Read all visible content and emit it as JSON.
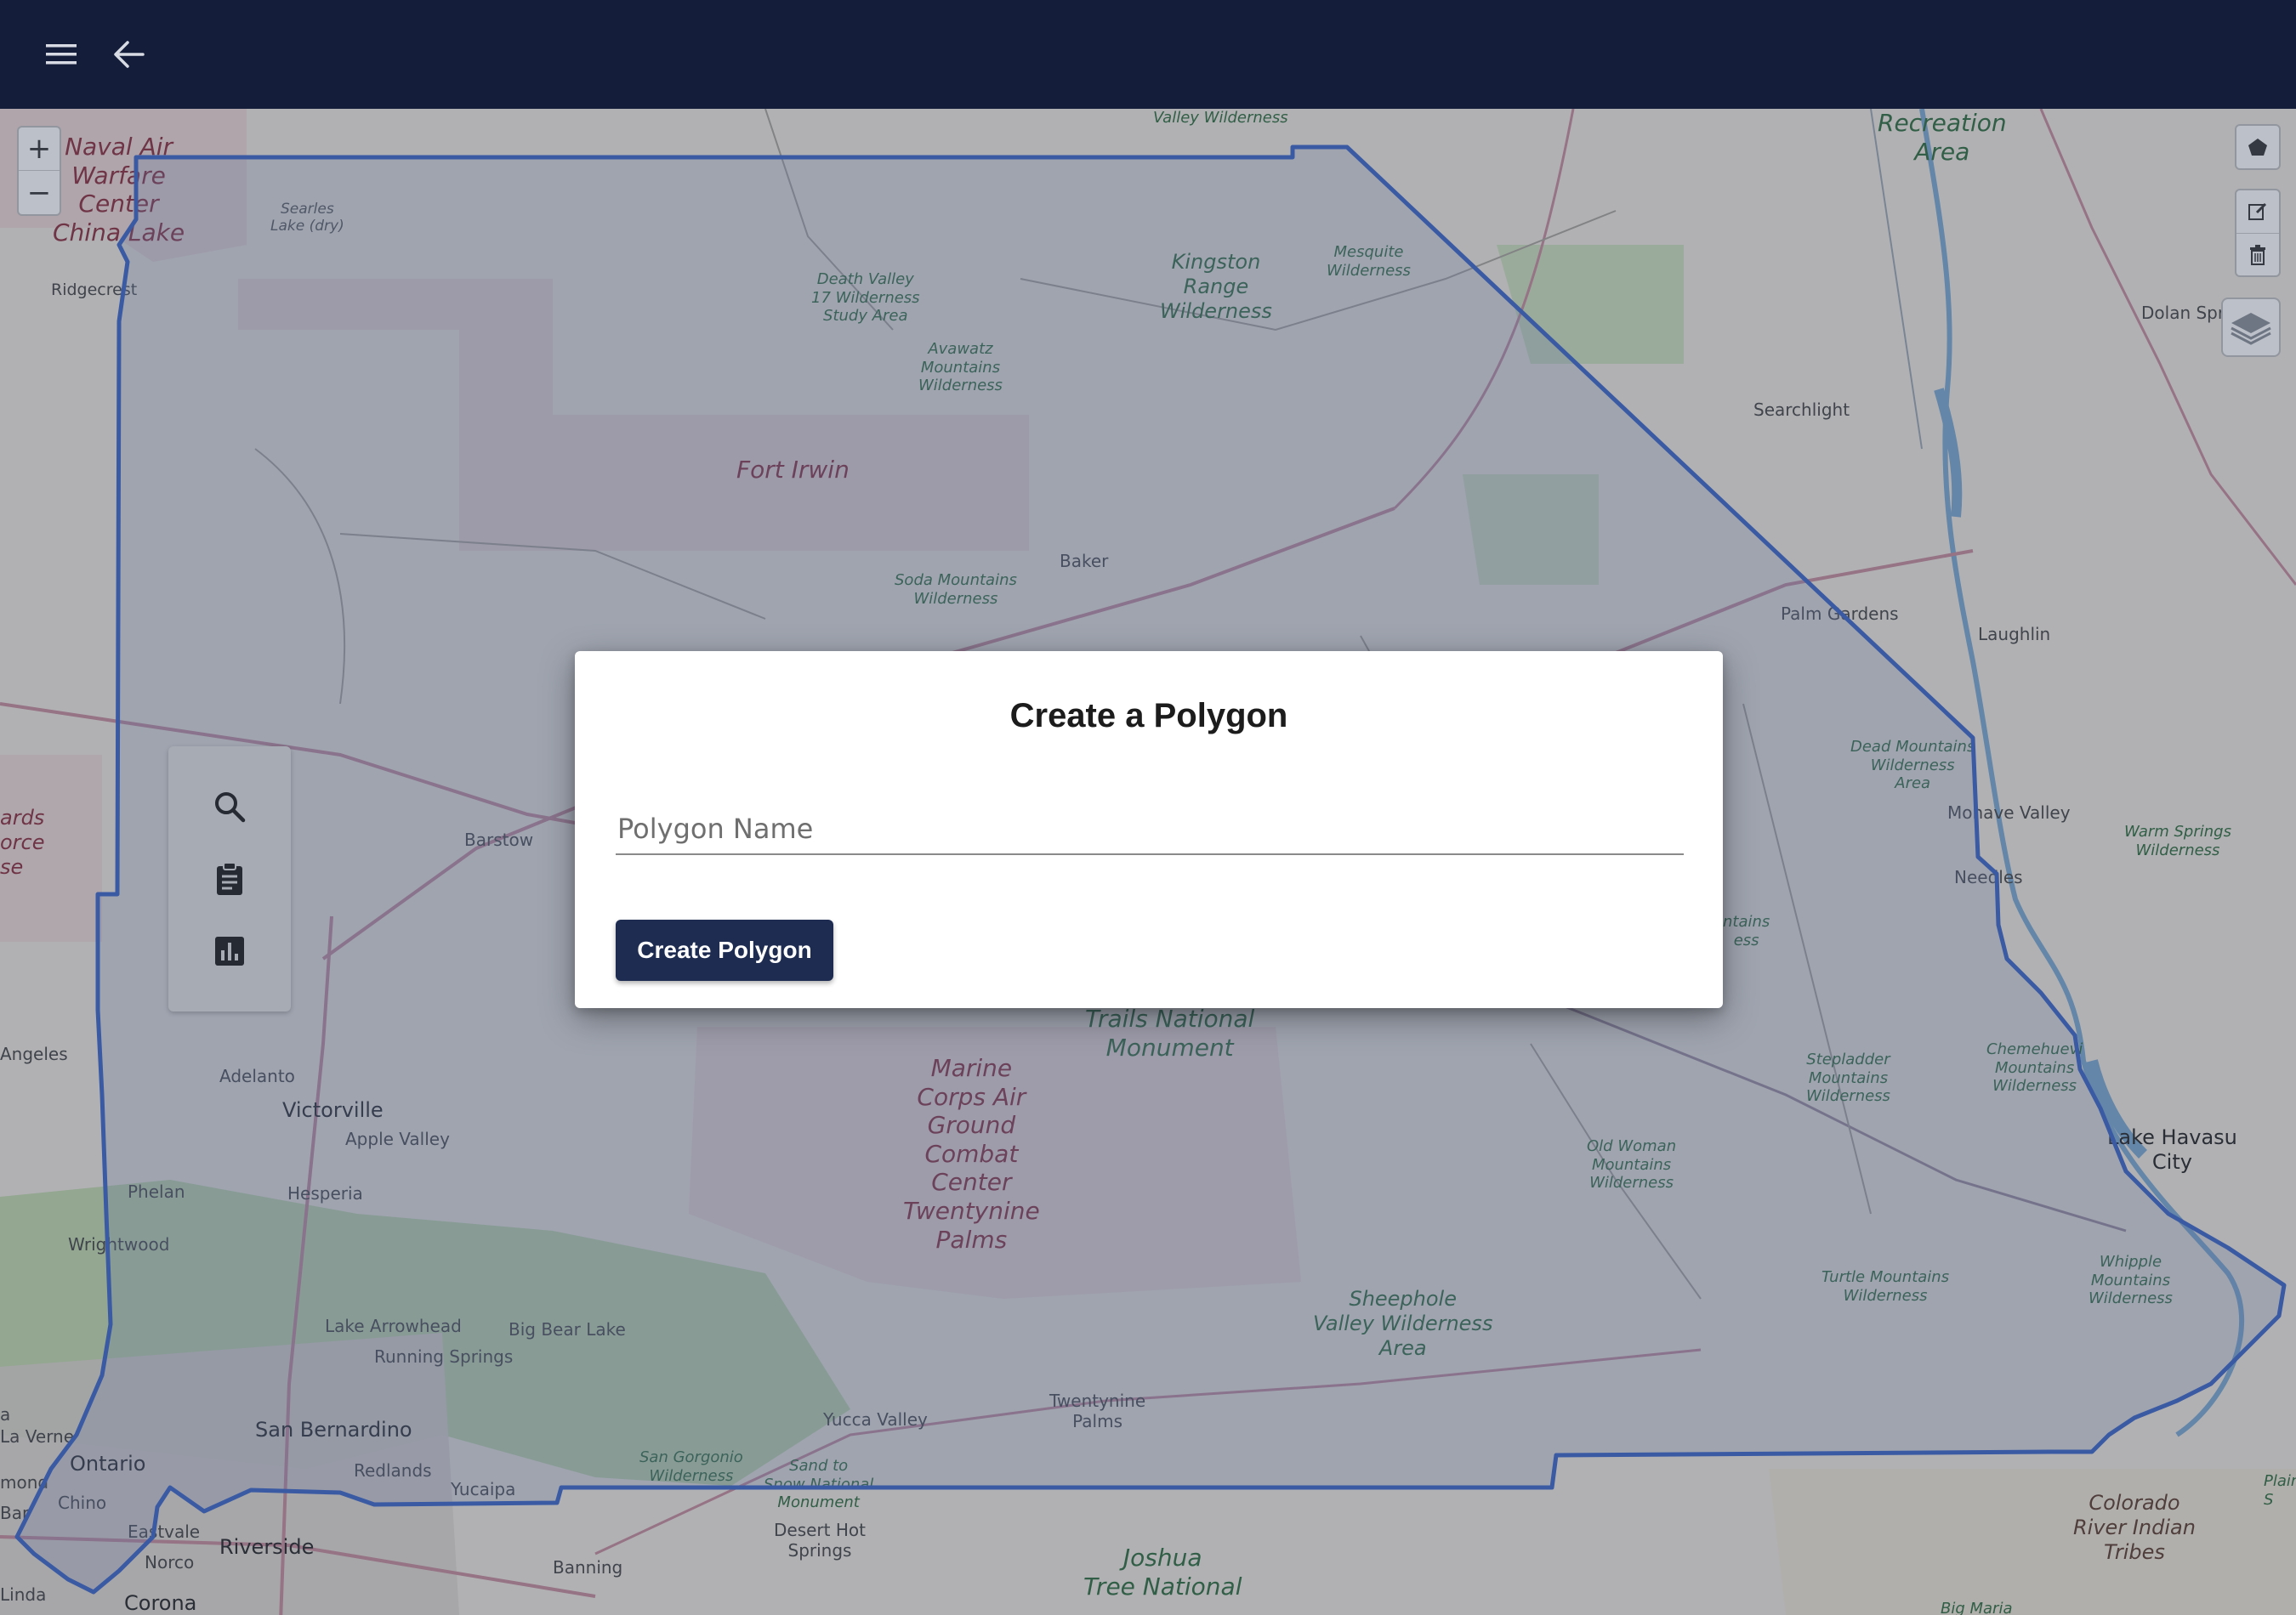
{
  "topbar": {
    "menu_icon": "menu-icon",
    "back_icon": "arrow-left-icon",
    "background": "#141e3a"
  },
  "map": {
    "zoom_in_label": "+",
    "zoom_out_label": "−",
    "tools": {
      "draw_polygon": "polygon-icon",
      "edit_layers": "edit-icon",
      "delete_layers": "trash-icon",
      "layer_switcher": "layers-icon"
    },
    "polygon_color": "#3a64c8",
    "labels": {
      "naval": "Naval Air\nWarfare\nCenter\nChina Lake",
      "searles": "Searles\nLake (dry)",
      "ridgecrest": "Ridgecrest",
      "valley_wild": "Valley Wilderness",
      "recreation": "Recreation\nArea",
      "death_valley": "Death Valley\n17 Wilderness\nStudy Area",
      "kingston": "Kingston\nRange\nWilderness",
      "mesquite": "Mesquite\nWilderness",
      "avawatz": "Avawatz\nMountains\nWilderness",
      "dolan": "Dolan Spr",
      "fort_irwin": "Fort Irwin",
      "searchlight": "Searchlight",
      "baker": "Baker",
      "soda": "Soda Mountains\nWilderness",
      "palm_gardens": "Palm Gardens",
      "laughlin": "Laughlin",
      "dead_mountains": "Dead Mountains\nWilderness\nArea",
      "mohave_valley": "Mohave Valley",
      "warm_springs": "Warm Springs\nWilderness",
      "needles": "Needles",
      "ards": "ards\norce\nse",
      "barstow": "Barstow",
      "ntains": "ntains\ness",
      "trails": "Trails National\nMonument",
      "marine": "Marine\nCorps Air\nGround\nCombat\nCenter\nTwentynine\nPalms",
      "stepladder": "Stepladder\nMountains\nWilderness",
      "chemehuevi": "Chemehuevi\nMountains\nWilderness",
      "angeles": "Angeles",
      "adelanto": "Adelanto",
      "victorville": "Victorville",
      "apple_valley": "Apple Valley",
      "old_woman": "Old Woman\nMountains\nWilderness",
      "lake_havasu": "Lake Havasu\nCity",
      "phelan": "Phelan",
      "hesperia": "Hesperia",
      "wrightwood": "Wrightwood",
      "whipple": "Whipple\nMountains\nWilderness",
      "turtle": "Turtle Mountains\nWilderness",
      "sheephole": "Sheephole\nValley Wilderness\nArea",
      "lake_arrowhead": "Lake Arrowhead",
      "big_bear": "Big Bear Lake",
      "running_springs": "Running Springs",
      "twentynine_palms": "Twentynine\nPalms",
      "yucca_valley": "Yucca Valley",
      "san_bernardino": "San Bernardino",
      "la_verne": "La Verne",
      "ontario": "Ontario",
      "redlands": "Redlands",
      "san_gorgonio": "San Gorgonio\nWilderness",
      "sand_to_snow": "Sand to\nSnow National\nMonument",
      "yucaipa": "Yucaipa",
      "mond": "mond",
      "chino": "Chino",
      "bar": "Bar",
      "desert_hot_springs": "Desert Hot\nSprings",
      "colorado_river": "Colorado\nRiver Indian\nTribes",
      "plain": "Plain\nS",
      "eastvale": "Eastvale",
      "riverside": "Riverside",
      "norco": "Norco",
      "banning": "Banning",
      "joshua": "Joshua\nTree National",
      "linda": "Linda",
      "corona": "Corona",
      "big_maria": "Big Maria",
      "a": "a"
    }
  },
  "side_panel": {
    "search_icon": "search-icon",
    "clipboard_icon": "clipboard-icon",
    "chart_icon": "bar-chart-icon"
  },
  "dialog": {
    "title": "Create a Polygon",
    "name_placeholder": "Polygon Name",
    "name_value": "",
    "submit_label": "Create Polygon",
    "button_color": "#1e2c52"
  }
}
